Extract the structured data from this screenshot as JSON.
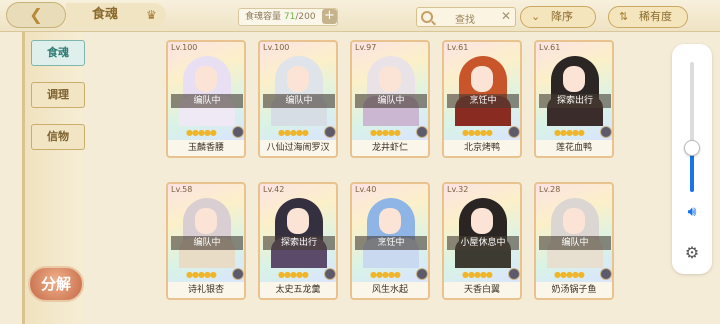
{
  "topbar": {
    "back_icon": "back-arrow-icon",
    "title": "食魂",
    "capacity_label": "食魂容量",
    "capacity_current": "71",
    "capacity_max": "/200",
    "search_placeholder": "查找",
    "sort_order_label": "降序",
    "sort_rarity_label": "稀有度"
  },
  "sidebar": {
    "tabs": [
      {
        "label": "食魂",
        "active": true
      },
      {
        "label": "调理",
        "active": false
      },
      {
        "label": "信物",
        "active": false
      }
    ],
    "decompose_label": "分解"
  },
  "cards": [
    {
      "level": "Lv.100",
      "status": "编队中",
      "name": "玉麟香腰",
      "hair": "#e8e0f2",
      "robe": "#efe8f5"
    },
    {
      "level": "Lv.100",
      "status": "编队中",
      "name": "八仙过海闹罗汉",
      "hair": "#dfe4ea",
      "robe": "#d6dde4"
    },
    {
      "level": "Lv.97",
      "status": "编队中",
      "name": "龙井虾仁",
      "hair": "#e9e3e8",
      "robe": "#cbb7d2"
    },
    {
      "level": "Lv.61",
      "status": "烹饪中",
      "name": "北京烤鸭",
      "hair": "#c9552b",
      "robe": "#8a2b22"
    },
    {
      "level": "Lv.61",
      "status": "探索出行",
      "name": "莲花血鸭",
      "hair": "#2b2523",
      "robe": "#3a2c2a"
    },
    {
      "level": "Lv.58",
      "status": "编队中",
      "name": "诗礼银杏",
      "hair": "#d9cfd2",
      "robe": "#e9dcc7"
    },
    {
      "level": "Lv.42",
      "status": "探索出行",
      "name": "太史五龙羹",
      "hair": "#353040",
      "robe": "#5b4a6a"
    },
    {
      "level": "Lv.40",
      "status": "烹饪中",
      "name": "风生水起",
      "hair": "#8fb5e6",
      "robe": "#c8d9f0"
    },
    {
      "level": "Lv.32",
      "status": "小屋休息中",
      "name": "天香白翼",
      "hair": "#2a2522",
      "robe": "#3d3a32"
    },
    {
      "level": "Lv.28",
      "status": "编队中",
      "name": "奶汤锅子鱼",
      "hair": "#dcd6d3",
      "robe": "#e7dfd0"
    }
  ]
}
